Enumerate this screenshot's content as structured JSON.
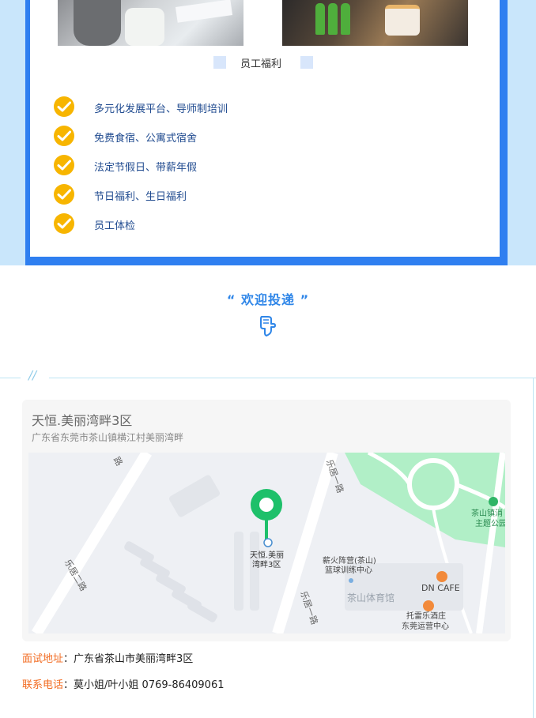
{
  "benefits": {
    "title": "员工福利",
    "items": [
      "多元化发展平台、导师制培训",
      "免费食宿、公寓式宿舍",
      "法定节假日、带薪年假",
      "节日福利、生日福利",
      "员工体检"
    ]
  },
  "welcome": {
    "text": "“ 欢迎投递 ”"
  },
  "location": {
    "name": "天恒.美丽湾畔3区",
    "address": "广东省东莞市茶山镇横江村美丽湾畔",
    "map_labels": {
      "road1": "乐居一路",
      "road2": "乐居二路",
      "road3": "乐居一路",
      "pin": "天恒.美丽湾畔3区",
      "park": "茶山镇消主题公园",
      "court": "薪火阵营(茶山)篮球训练中心",
      "cafe": "DN CAFE",
      "stadium": "茶山体育馆",
      "hotel": "托雷乐酒庄东莞运营中心"
    }
  },
  "contact": {
    "interview_label": "面试地址",
    "interview_value": "广东省茶山市美丽湾畔3区",
    "phone_label": "联系电话",
    "phone_value": "莫小姐/叶小姐 0769-86409061"
  },
  "colors": {
    "frame_blue": "#2f7ff0",
    "check_yellow": "#f7b500",
    "accent_orange": "#f26b21",
    "pin_green": "#1ec06a"
  }
}
